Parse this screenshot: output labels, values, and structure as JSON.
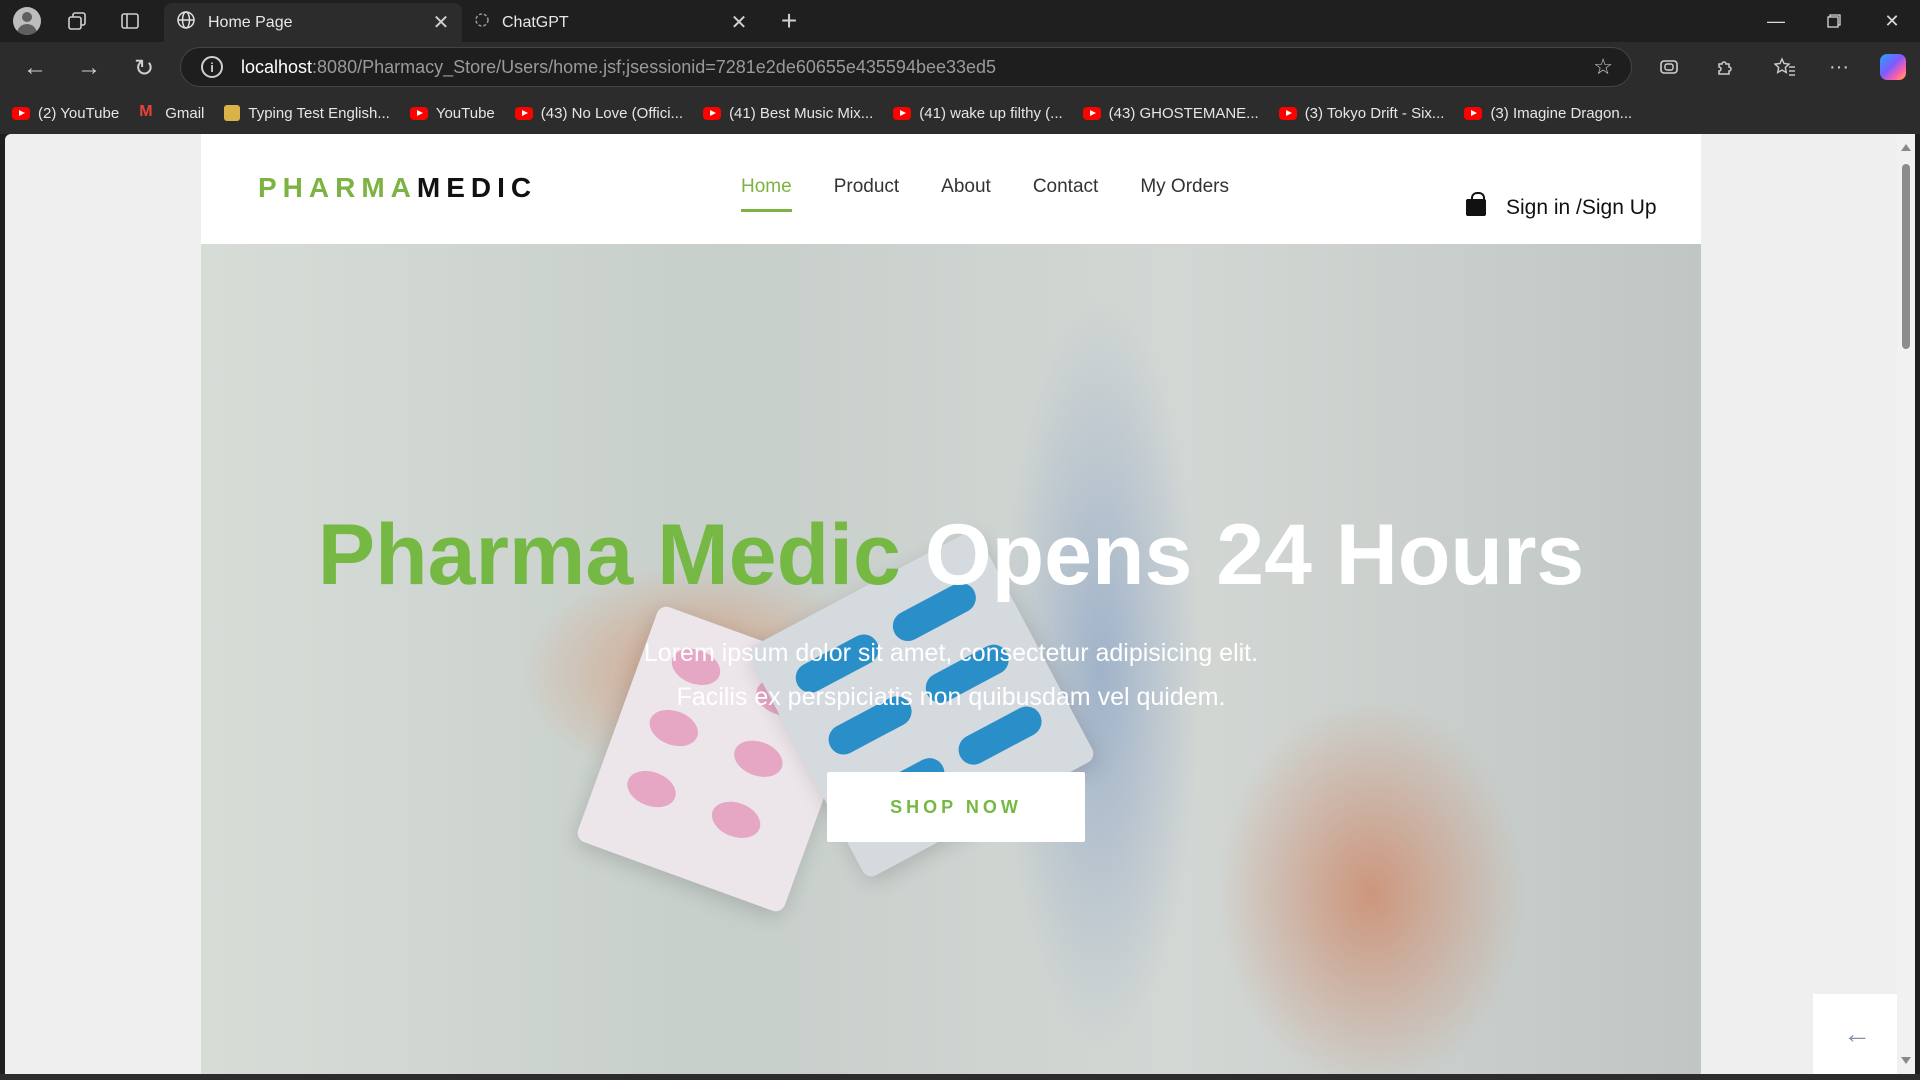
{
  "browser": {
    "tabs": [
      {
        "label": "Home Page",
        "active": true
      },
      {
        "label": "ChatGPT",
        "active": false
      }
    ],
    "address": {
      "host": "localhost",
      "path": ":8080/Pharmacy_Store/Users/home.jsf;jsessionid=7281e2de60655e435594bee33ed5"
    },
    "bookmarks": [
      {
        "label": "(2) YouTube",
        "icon": "youtube-icon"
      },
      {
        "label": "Gmail",
        "icon": "gmail-icon"
      },
      {
        "label": "Typing Test English...",
        "icon": "typing-test-icon"
      },
      {
        "label": "YouTube",
        "icon": "youtube-icon"
      },
      {
        "label": "(43) No Love (Offici...",
        "icon": "youtube-icon"
      },
      {
        "label": "(41) Best Music Mix...",
        "icon": "youtube-icon"
      },
      {
        "label": "(41) wake up filthy (...",
        "icon": "youtube-icon"
      },
      {
        "label": "(43) GHOSTEMANE...",
        "icon": "youtube-icon"
      },
      {
        "label": "(3) Tokyo Drift - Six...",
        "icon": "youtube-icon"
      },
      {
        "label": "(3) Imagine Dragon...",
        "icon": "youtube-icon"
      }
    ]
  },
  "site": {
    "logo": {
      "part1": "PHARMA",
      "part2": "MEDIC"
    },
    "menu": [
      {
        "label": "Home",
        "active": true
      },
      {
        "label": "Product"
      },
      {
        "label": "About"
      },
      {
        "label": "Contact"
      },
      {
        "label": "My Orders"
      }
    ],
    "signin": "Sign in /Sign Up",
    "hero": {
      "title_green": "Pharma Medic",
      "title_white": "Opens 24 Hours",
      "line1": "Lorem ipsum dolor sit amet, consectetur adipisicing elit.",
      "line2": "Facilis ex perspiciatis non quibusdam vel quidem.",
      "button": "SHOP NOW"
    }
  },
  "colors": {
    "brand_green": "#76b844",
    "chrome_dark": "#1f1f1f",
    "chrome_mid": "#2c2c2c"
  }
}
